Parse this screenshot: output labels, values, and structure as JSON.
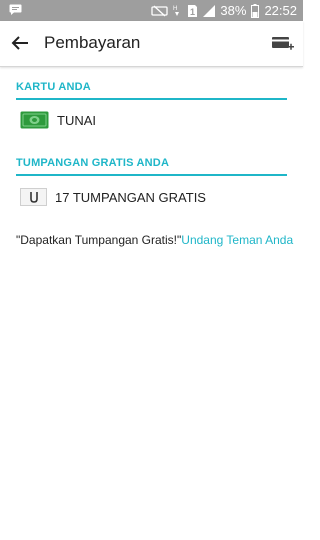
{
  "status_bar": {
    "battery": "38%",
    "time": "22:52"
  },
  "app_bar": {
    "title": "Pembayaran"
  },
  "cards_section": {
    "header": "KARTU ANDA",
    "items": [
      {
        "label": "TUNAI",
        "icon": "cash-icon"
      }
    ]
  },
  "free_rides_section": {
    "header": "TUMPANGAN GRATIS ANDA",
    "items": [
      {
        "label": "17 TUMPANGAN GRATIS",
        "icon": "uber-u-icon"
      }
    ]
  },
  "invite": {
    "prompt": "\"Dapatkan Tumpangan Gratis!\"",
    "link": "Undang Teman Anda"
  },
  "colors": {
    "accent": "#1fb6c8",
    "status_bar": "#9e9e9e",
    "cash_green": "#2e9a3c"
  }
}
